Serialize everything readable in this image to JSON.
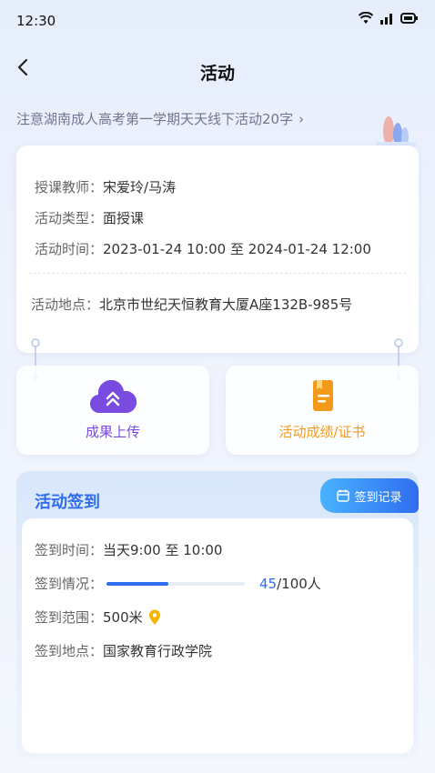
{
  "status_bar": {
    "time": "12:30"
  },
  "nav": {
    "title": "活动"
  },
  "notice": {
    "text": "注意湖南成人高考第一学期天天线下活动20字",
    "arrow": "›"
  },
  "info": {
    "teacher_key": "授课教师：",
    "teacher_val": "宋爱玲/马涛",
    "type_key": "活动类型：",
    "type_val": "面授课",
    "time_key": "活动时间：",
    "time_val": "2023-01-24 10:00 至 2024-01-24 12:00",
    "place_key": "活动地点：",
    "place_val": "北京市世纪天恒教育大厦A座132B-985号"
  },
  "actions": {
    "upload_label": "成果上传",
    "certificate_label": "活动成绩/证书"
  },
  "sign": {
    "title": "活动签到",
    "record_label": "签到记录",
    "time_key": "签到时间：",
    "time_val": "当天9:00 至 10:00",
    "status_key": "签到情况：",
    "count": "45",
    "total": "/100人",
    "progress": 0.45,
    "range_key": "签到范围：",
    "range_val": "500米",
    "place_key": "签到地点：",
    "place_val": "国家教育行政学院"
  },
  "colors": {
    "accent": "#2f6df0",
    "upload_purple": "#7a4be0",
    "cert_orange": "#f39a1b"
  },
  "icons": [
    "wifi-icon",
    "signal-icon",
    "battery-icon",
    "back-arrow-icon",
    "cloud-upload-icon",
    "certificate-icon",
    "calendar-icon",
    "location-pin-icon"
  ]
}
